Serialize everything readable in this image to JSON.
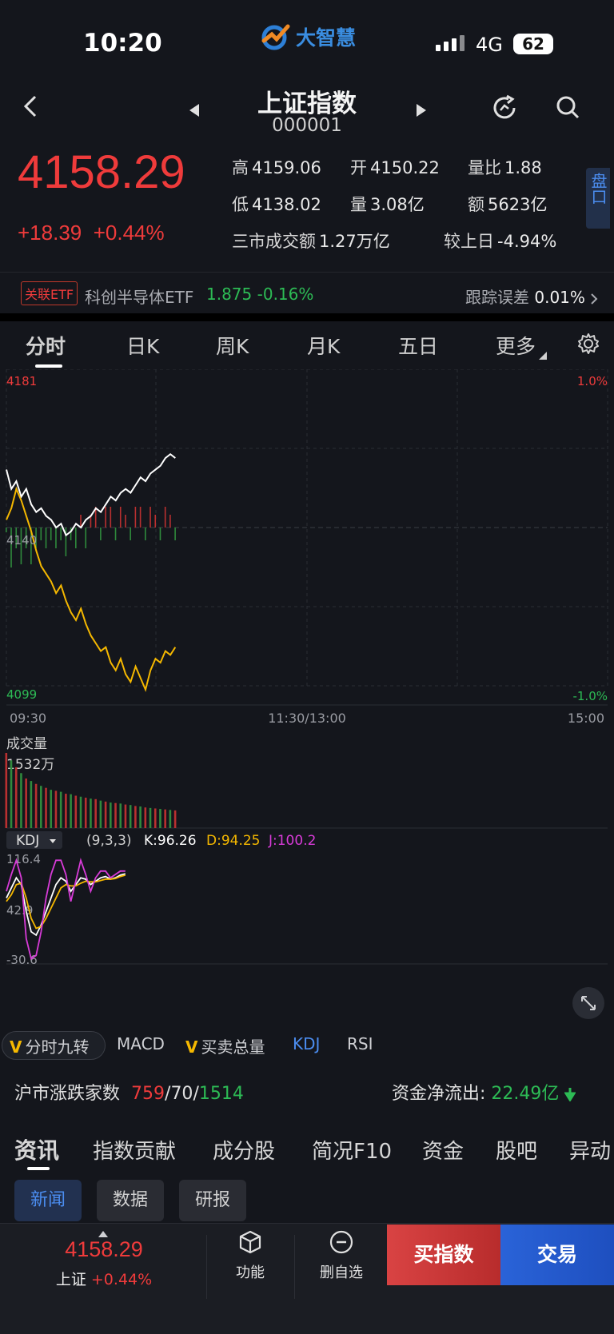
{
  "status_bar": {
    "time": "10:20",
    "network": "4G",
    "battery": "62",
    "app_name": "大智慧"
  },
  "header": {
    "title": "上证指数",
    "code": "000001"
  },
  "quote": {
    "price": "4158.29",
    "change": "+18.39",
    "change_pct": "+0.44%",
    "high_label": "高",
    "high": "4159.06",
    "open_label": "开",
    "open": "4150.22",
    "vol_ratio_label": "量比",
    "vol_ratio": "1.88",
    "low_label": "低",
    "low": "4138.02",
    "volume_label": "量",
    "volume": "3.08亿",
    "amount_label": "额",
    "amount": "5623亿",
    "market_turnover_label": "三市成交额",
    "market_turnover": "1.27万亿",
    "vs_prev_label": "较上日",
    "vs_prev": "-4.94%",
    "pankou_label": "盘口"
  },
  "etf": {
    "tag": "关联ETF",
    "name": "科创半导体ETF",
    "price": "1.875",
    "change": "-0.16%",
    "tracking_label": "跟踪误差",
    "tracking_value": "0.01%"
  },
  "chart_tabs": [
    "分时",
    "日K",
    "周K",
    "月K",
    "五日",
    "更多"
  ],
  "intraday": {
    "y_top_price": "4181",
    "y_mid_price": "4140",
    "y_bottom_price": "4099",
    "y_top_pct": "1.0%",
    "y_bottom_pct": "-1.0%",
    "x_start": "09:30",
    "x_mid": "11:30/13:00",
    "x_end": "15:00",
    "volume_title": "成交量",
    "volume_max": "1532万",
    "kdj_label": "KDJ",
    "kdj_params": "(9,3,3)",
    "kdj_k": "K:96.26",
    "kdj_d": "D:94.25",
    "kdj_j": "J:100.2",
    "kdj_ticks": [
      "116.4",
      "42.9",
      "-30.6"
    ]
  },
  "chart_data": {
    "type": "line",
    "x_range": [
      "09:30",
      "15:00"
    ],
    "ylim": [
      4099,
      4181
    ],
    "series": [
      {
        "values": [
          4155,
          4150,
          4152,
          4148,
          4150,
          4146,
          4144,
          4145,
          4143,
          4142,
          4140,
          4141,
          4138,
          4139,
          4141,
          4140,
          4142,
          4143,
          4145,
          4144,
          4146,
          4148,
          4147,
          4149,
          4150,
          4149,
          4151,
          4153,
          4152,
          4154,
          4155,
          4156,
          4158,
          4159,
          4158
        ]
      },
      {
        "values": [
          4142,
          4145,
          4150,
          4147,
          4143,
          4139,
          4134,
          4130,
          4128,
          4126,
          4123,
          4125,
          4121,
          4118,
          4116,
          4119,
          4115,
          4112,
          4110,
          4108,
          4109,
          4105,
          4103,
          4106,
          4102,
          4100,
          4104,
          4101,
          4098,
          4103,
          4106,
          4105,
          4108,
          4107,
          4109
        ]
      }
    ],
    "volume": [
      1532,
      1380,
      1240,
      1120,
      1010,
      960,
      900,
      860,
      820,
      780,
      760,
      740,
      700,
      690,
      660,
      640,
      620,
      600,
      590,
      560,
      540,
      520,
      510,
      500,
      480,
      470,
      450,
      440,
      420,
      410,
      400,
      390,
      380,
      370,
      360
    ],
    "kdj": {
      "K": [
        60,
        75,
        90,
        80,
        40,
        10,
        5,
        20,
        40,
        60,
        80,
        90,
        85,
        70,
        80,
        90,
        88,
        80,
        85,
        90,
        92,
        88,
        90,
        94,
        96
      ],
      "D": [
        55,
        65,
        80,
        82,
        60,
        30,
        15,
        18,
        30,
        45,
        60,
        75,
        80,
        78,
        78,
        82,
        85,
        84,
        84,
        86,
        88,
        88,
        89,
        92,
        94
      ],
      "J": [
        70,
        95,
        116,
        90,
        0,
        -30,
        -25,
        10,
        60,
        95,
        116,
        116,
        95,
        55,
        85,
        116,
        95,
        70,
        90,
        100,
        100,
        90,
        95,
        100,
        100
      ]
    }
  },
  "indicator_tabs": [
    "分时九转",
    "MACD",
    "买卖总量",
    "KDJ",
    "RSI"
  ],
  "market_breadth": {
    "label": "沪市涨跌家数",
    "up": "759",
    "flat": "70",
    "down": "1514"
  },
  "fund_flow": {
    "label": "资金净流出:",
    "value": "22.49亿"
  },
  "news_tabs": [
    "资讯",
    "指数贡献",
    "成分股",
    "简况F10",
    "资金",
    "股吧",
    "异动"
  ],
  "chips": [
    "新闻",
    "数据",
    "研报"
  ],
  "bottom_bar": {
    "price": "4158.29",
    "name": "上证",
    "change_pct": "+0.44%",
    "function_label": "功能",
    "remove_label": "删自选",
    "buy_label": "买指数",
    "trade_label": "交易"
  },
  "colors": {
    "up": "#ef3b3b",
    "down": "#2dbb55",
    "accent": "#4b8df0",
    "price_line": "#ffffff",
    "avg_line": "#f5b800",
    "kdj_k": "#ffffff",
    "kdj_d": "#f5b800",
    "kdj_j": "#d83bd8"
  }
}
